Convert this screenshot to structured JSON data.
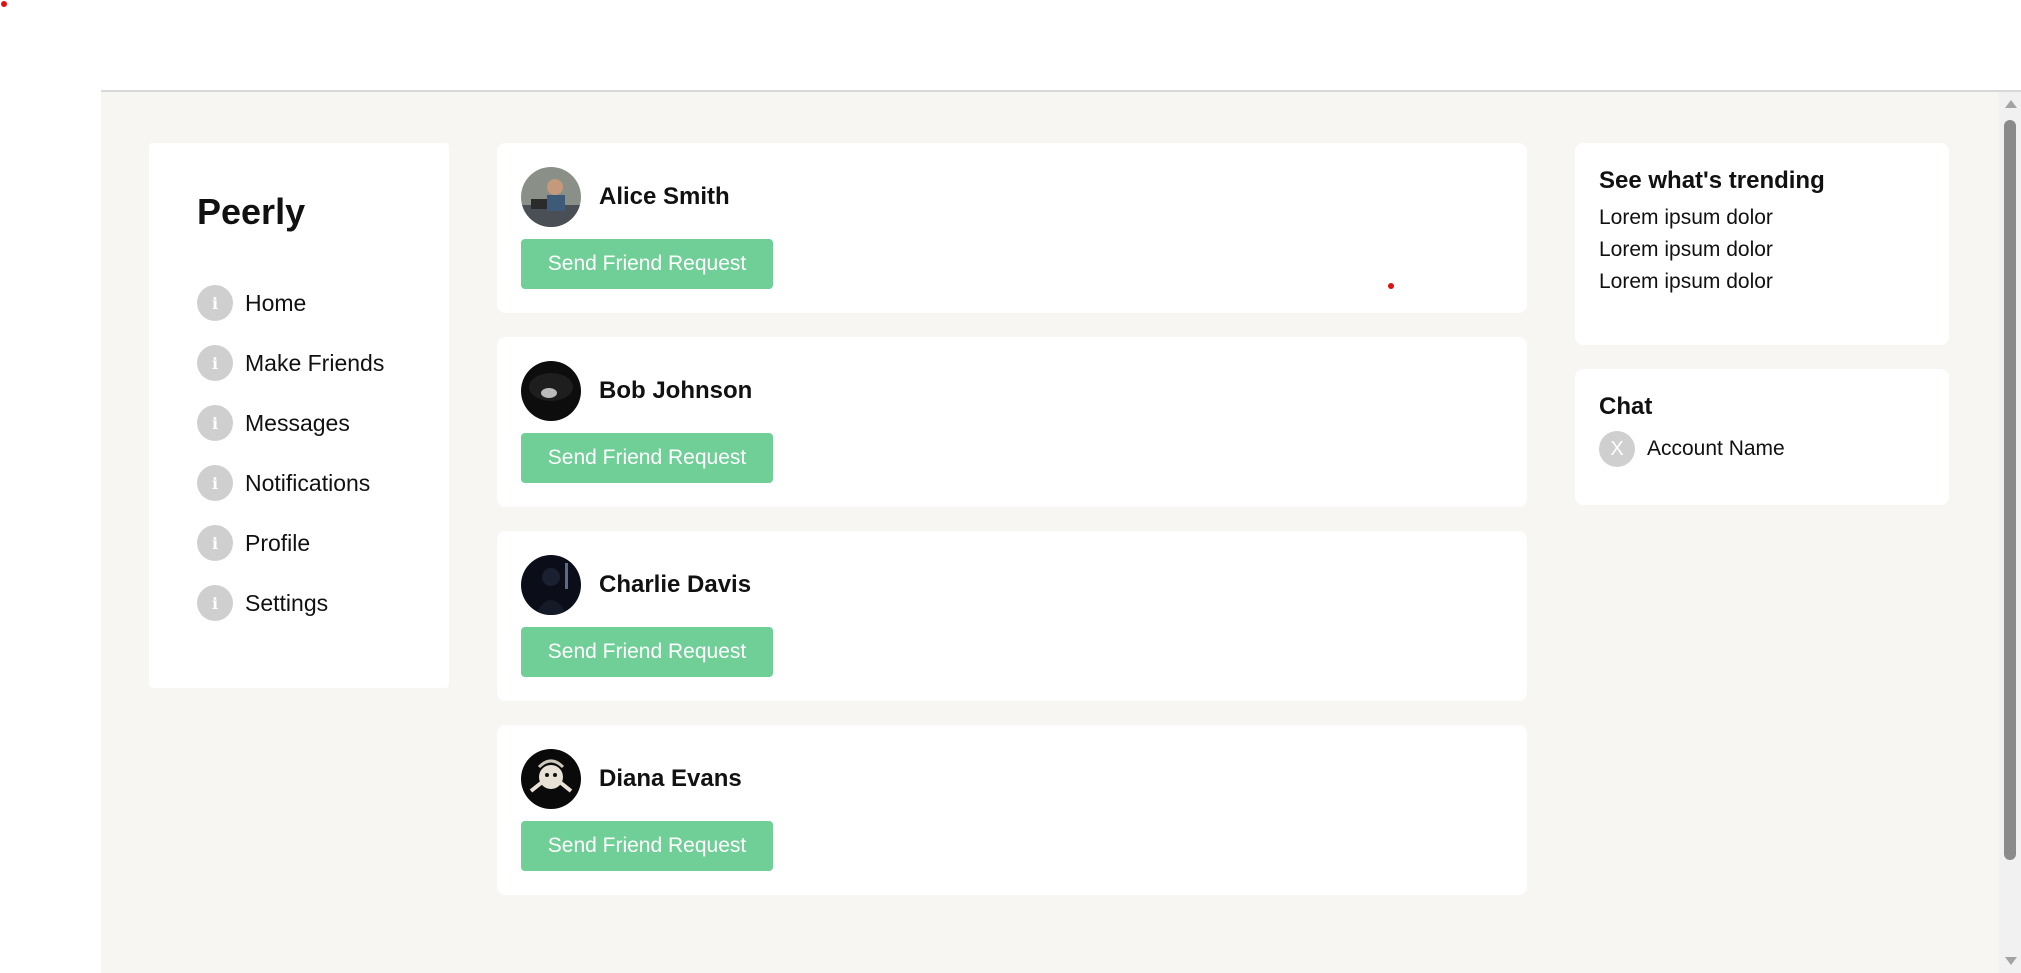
{
  "brand": {
    "name": "Peerly"
  },
  "nav": {
    "items": [
      {
        "label": "Home",
        "icon": "info-icon",
        "glyph": "i"
      },
      {
        "label": "Make Friends",
        "icon": "info-icon",
        "glyph": "i"
      },
      {
        "label": "Messages",
        "icon": "info-icon",
        "glyph": "i"
      },
      {
        "label": "Notifications",
        "icon": "info-icon",
        "glyph": "i"
      },
      {
        "label": "Profile",
        "icon": "info-icon",
        "glyph": "i"
      },
      {
        "label": "Settings",
        "icon": "info-icon",
        "glyph": "i"
      }
    ]
  },
  "feed": {
    "cards": [
      {
        "name": "Alice Smith",
        "button_label": "Send Friend Request"
      },
      {
        "name": "Bob Johnson",
        "button_label": "Send Friend Request"
      },
      {
        "name": "Charlie Davis",
        "button_label": "Send Friend Request"
      },
      {
        "name": "Diana Evans",
        "button_label": "Send Friend Request"
      }
    ]
  },
  "trending": {
    "title": "See what's trending",
    "items": [
      "Lorem ipsum dolor",
      "Lorem ipsum dolor",
      "Lorem ipsum dolor"
    ]
  },
  "chat": {
    "title": "Chat",
    "avatar_glyph": "X",
    "account_name": "Account Name"
  },
  "colors": {
    "accent": "#6fcf97",
    "background": "#f7f6f3",
    "icon_gray": "#cfcfcf"
  }
}
